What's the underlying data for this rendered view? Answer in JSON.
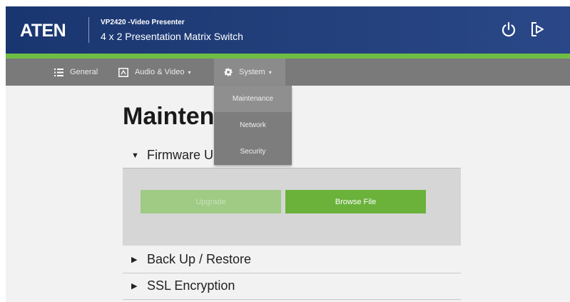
{
  "header": {
    "logo": "ATEN",
    "model": "VP2420 -Video Presenter",
    "product": "4 x 2 Presentation Matrix Switch",
    "accent_color": "#6fbe44",
    "power_icon": "power-icon",
    "logout_icon": "logout-icon"
  },
  "nav": {
    "items": [
      {
        "label": "General",
        "icon": "list-icon"
      },
      {
        "label": "Audio & Video",
        "icon": "av-icon"
      },
      {
        "label": "System",
        "icon": "gear-icon"
      }
    ],
    "caret": "▾"
  },
  "dropdown": {
    "items": [
      "Maintenance",
      "Network",
      "Security"
    ],
    "selected": "Maintenance"
  },
  "page": {
    "title": "Maintenance",
    "sections": [
      {
        "label": "Firmware Upgrade",
        "expanded": true
      },
      {
        "label": "Back Up / Restore",
        "expanded": false
      },
      {
        "label": "SSL Encryption",
        "expanded": false
      }
    ],
    "firmware": {
      "upgrade_label": "Upgrade",
      "browse_label": "Browse File"
    }
  },
  "icons": {
    "expanded": "▼",
    "collapsed": "▶"
  }
}
